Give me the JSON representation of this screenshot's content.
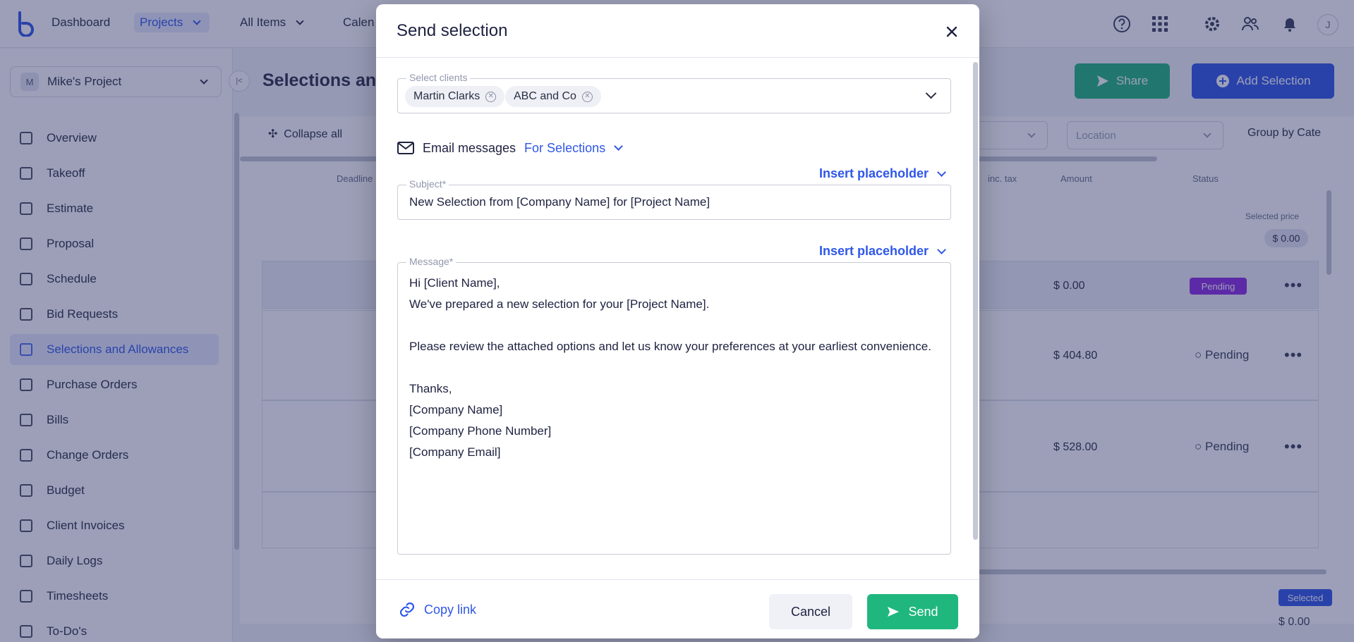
{
  "app": {
    "nav": [
      "Dashboard",
      "Projects",
      "All Items",
      "Calen"
    ],
    "user_initial": "J",
    "project": "Mike's Project",
    "project_initial": "M",
    "sidebar_items": [
      "Overview",
      "Takeoff",
      "Estimate",
      "Proposal",
      "Schedule",
      "Bid Requests",
      "Selections and Allowances",
      "Purchase Orders",
      "Bills",
      "Change Orders",
      "Budget",
      "Client Invoices",
      "Daily Logs",
      "Timesheets",
      "To-Do's"
    ],
    "page_title": "Selections and",
    "share_label": "Share",
    "add_selection_label": "Add Selection",
    "collapse_all": "Collapse all",
    "location_placeholder": "Location",
    "group_by": "Group by Cate",
    "columns": [
      "Deadline",
      "inc. tax",
      "Amount",
      "Status"
    ],
    "selected_price_label": "Selected price",
    "selected_price_value": "$ 0.00",
    "rows": [
      {
        "amount": "$ 0.00",
        "status": "Pending"
      },
      {
        "amount": "$ 404.80",
        "status": "Pending"
      },
      {
        "amount": "$ 528.00",
        "status": "Pending"
      }
    ],
    "selected_badge": "Selected",
    "bottom_total": "$ 0.00"
  },
  "modal": {
    "title": "Send selection",
    "clients_label": "Select clients",
    "clients": [
      "Martin Clarks",
      "ABC and Co"
    ],
    "email_messages_label": "Email messages",
    "email_type": "For Selections",
    "insert_placeholder": "Insert placeholder",
    "subject_label": "Subject*",
    "subject_value": "New Selection from [Company Name] for [Project Name]",
    "message_label": "Message*",
    "message_value": "Hi [Client Name],\nWe've prepared a new selection for your [Project Name].\n\nPlease review the attached options and let us know your preferences at your earliest convenience.\n\nThanks,\n[Company Name]\n[Company Phone Number]\n[Company Email]",
    "copy_link": "Copy link",
    "cancel": "Cancel",
    "send": "Send"
  },
  "colors": {
    "accent": "#2f57e8",
    "success": "#1fb77e",
    "pending_badge": "#8a2be2"
  }
}
